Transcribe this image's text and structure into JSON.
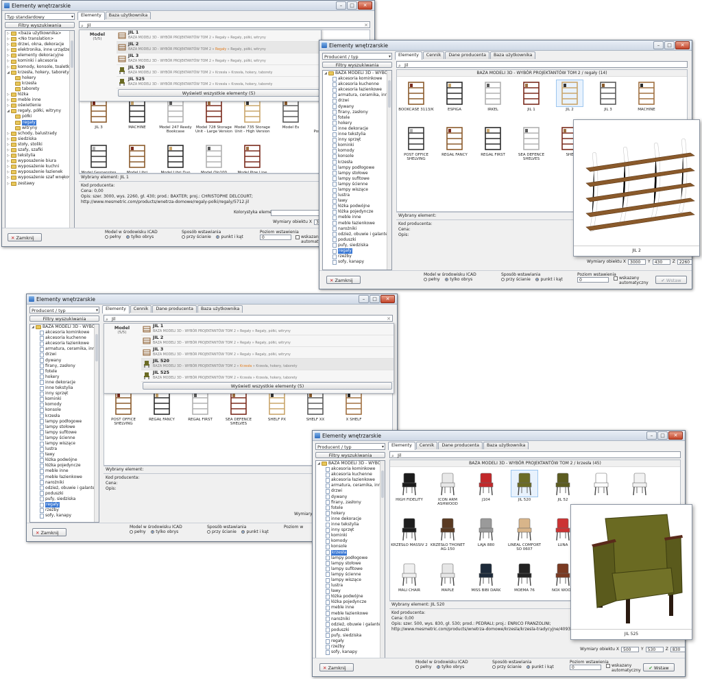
{
  "windows": {
    "w1": {
      "title": "Elementy wnętrzarskie",
      "combo": "Typ standardowy",
      "filter_btn": "Filtry wyszukiwania",
      "tabs": [
        "Elementy",
        "Baza użytkownika"
      ],
      "search_value": "Jil",
      "tree": [
        "<baza użytkownika>",
        "<No translation>",
        "drzwi, okna, dekoracje",
        "elektronika, inne urządzenia",
        "elementy dekoracyjne",
        "kominki i akcesoria",
        "komody, konsole, toaletki",
        "krzesła, hokery, taborety",
        "hokery",
        "krzesła",
        "taborety",
        "łóżka",
        "meble inne",
        "oświetlenie",
        "regały, półki, witryny",
        "półki",
        "regały",
        "witryny",
        "schody, balustrady",
        "siedziska",
        "stoły, stoliki",
        "szafy, szafki",
        "tekstylia",
        "wyposażenie biura",
        "wyposażenie kuchni",
        "wyposażenie łazienek",
        "wyposażenie szaf wnękowych",
        "zestawy"
      ],
      "popup": {
        "label": "Model",
        "count": "(5/5)",
        "rows": [
          {
            "name": "JIL 1",
            "path": "BAZA MODELI 3D - WYBÓR PROJEKTANTÓW TOM 2 » Regały » Regały, półki, witryny"
          },
          {
            "name": "JIL 2",
            "path_a": "BAZA MODELI 3D - WYBÓR PROJEKTANTÓW TOM 2 » ",
            "path_hl": "Regały",
            "path_b": " » Regały, półki, witryny"
          },
          {
            "name": "JIL 3",
            "path": "BAZA MODELI 3D - WYBÓR PROJEKTANTÓW TOM 2 » Regały » Regały, półki, witryny"
          },
          {
            "name": "JIL 520",
            "path": "BAZA MODELI 3D - WYBÓR PROJEKTANTÓW TOM 2 » Krzesła » Krzesła, hokery, taborety"
          },
          {
            "name": "JIL 525",
            "path": "BAZA MODELI 3D - WYBÓR PROJEKTANTÓW TOM 2 » Krzesła » Krzesła, hokery, taborety"
          }
        ],
        "show_all": "Wyświetl wszystkie elementy (5)"
      },
      "thumbs": [
        "JIL 3",
        "MACHINE",
        "Model 247 Reedy Bookcase",
        "Model 728 Storage Unit - Large Version",
        "Model 735 Storage Unit - High Version",
        "Model Es",
        "Model Frip Postmeister 259",
        "Model Gespanntes Regal",
        "Model Libri",
        "Model Libri Duo",
        "Model Olo100",
        "Model Pipe Line"
      ],
      "selected": "Wybrany element: JIL 1",
      "info_code": "Kod producenta:",
      "info_price": "Cena: 0,00",
      "info_desc": "Opis: szer. 3000, wys. 2260, gł. 430; prod.: BAXTER; proj.: CHRISTOPHE DELCOURT;",
      "info_url": "http://www.mesmetric.com/products/wnetrza-domowe/regaly-polki/regaly/5712.jil",
      "char_label": "Kolorystyka elementu",
      "dims_label": "Wymiary obiektu",
      "dim_x_label": "X",
      "dim_x": "3000",
      "close": "Zamknij",
      "model_label": "Model w środowisku ICAD",
      "model_opt1": "pełny",
      "model_opt2": "tylko obrys",
      "mode_label": "Sposób wstawiania",
      "mode_opt1": "przy ścianie",
      "mode_opt2": "punkt i kąt",
      "level_label": "Poziom wstawienia",
      "level_value": "0",
      "auto_label": "wskazany",
      "auto_label2": "automatyczny"
    },
    "w2": {
      "title": "Elementy wnętrzarskie",
      "combo": "Producent / typ",
      "filter_btn": "Filtry wyszukiwania",
      "tabs": [
        "Elementy",
        "Cennik",
        "Dane producenta",
        "Baza użytkownika"
      ],
      "search_value": "Jil",
      "tree_root": "BAZA MODELI 3D - WYBÓR P",
      "tree": [
        "akcesoria kominkowe",
        "akcesoria kuchenne",
        "akcesoria łazienkowe",
        "armatura, ceramika, inne",
        "drzwi",
        "dywany",
        "firany, zasłony",
        "fotele",
        "hokery",
        "inne dekoracje",
        "inne tekstylia",
        "inny sprzęt",
        "kominki",
        "komody",
        "konsole",
        "krzesła",
        "lampy podłogowe",
        "lampy stołowe",
        "lampy sufitowe",
        "lampy ścienne",
        "lampy wiszące",
        "lustra",
        "ławy",
        "łóżka podwójne",
        "łóżka pojedyncze",
        "meble inne",
        "meble łazienkowe",
        "narożniki",
        "odzież, obuwie i galanteria",
        "poduszki",
        "pufy, siedziska",
        "regały",
        "rzeźby",
        "sofy, kanapy"
      ],
      "selected_tree": "regały",
      "grid_header": "BAZA MODELI 3D - WYBÓR PROJEKTANTÓW TOM 2 / regały (14)",
      "thumbs": [
        "BOOKCASE 3113/K",
        "ESPIGA",
        "IRKEL",
        "JIL 1",
        "JIL 2",
        "JIL 3",
        "MACHINE",
        "POST OFFICE SHELVING",
        "REGAŁ FANCY",
        "REGAŁ FIRST",
        "SEA DEFENCE SHELVES",
        "SHE"
      ],
      "selected": "Wybrany element:",
      "info_code": "Kod producenta:",
      "info_price": "Cena:",
      "info_desc": "Opis:",
      "preview_caption": "JIL 2",
      "dims_label": "Wymiary obiektu",
      "dim_x_label": "X",
      "dim_x": "3000",
      "dim_y_label": "Y",
      "dim_y": "430",
      "dim_z_label": "Z",
      "dim_z": "2260",
      "close": "Zamknij",
      "model_label": "Model w środowisku ICAD",
      "model_opt1": "pełny",
      "model_opt2": "tylko obrys",
      "mode_label": "Sposób wstawiania",
      "mode_opt1": "przy ścianie",
      "mode_opt2": "punkt i kąt",
      "level_label": "Poziom wstawienia",
      "level_value": "0",
      "auto_label": "wskazany",
      "auto_label2": "automatyczny",
      "ok": "Wstaw"
    },
    "w3": {
      "title": "Elementy wnętrzarskie",
      "combo": "Producent / typ",
      "filter_btn": "Filtry wyszukiwania",
      "tabs": [
        "Elementy",
        "Cennik",
        "Dane producenta",
        "Baza użytkownika"
      ],
      "search_value": "Jil",
      "tree_root": "BAZA MODELI 3D - WYBÓR P",
      "tree": [
        "akcesoria kominkowe",
        "akcesoria kuchenne",
        "akcesoria łazienkowe",
        "armatura, ceramika, inne",
        "drzwi",
        "dywany",
        "firany, zasłony",
        "fotele",
        "hokery",
        "inne dekoracje",
        "inne tekstylia",
        "inny sprzęt",
        "kominki",
        "komody",
        "konsole",
        "krzesła",
        "lampy podłogowe",
        "lampy stołowe",
        "lampy sufitowe",
        "lampy ścienne",
        "lampy wiszące",
        "lustra",
        "ławy",
        "łóżka podwójne",
        "łóżka pojedyncze",
        "meble inne",
        "meble łazienkowe",
        "narożniki",
        "odzież, obuwie i galanteria",
        "poduszki",
        "pufy, siedziska",
        "regały",
        "rzeźby",
        "sofy, kanapy"
      ],
      "selected_tree": "regały",
      "popup": {
        "label": "Model",
        "count": "(5/5)",
        "rows": [
          {
            "name": "JIL 1",
            "path": "BAZA MODELI 3D - WYBÓR PROJEKTANTÓW TOM 2 » Regały » Regały, półki, witryny"
          },
          {
            "name": "JIL 2",
            "path": "BAZA MODELI 3D - WYBÓR PROJEKTANTÓW TOM 2 » Regały » Regały, półki, witryny"
          },
          {
            "name": "JIL 3",
            "path": "BAZA MODELI 3D - WYBÓR PROJEKTANTÓW TOM 2 » Regały » Regały, półki, witryny"
          },
          {
            "name": "JIL 520",
            "path_a": "BAZA MODELI 3D - WYBÓR PROJEKTANTÓW TOM 2 » ",
            "path_hl": "Krzesła",
            "path_b": " » Krzesła, hokery, taborety"
          },
          {
            "name": "JIL 525",
            "path": "BAZA MODELI 3D - WYBÓR PROJEKTANTÓW TOM 2 » Krzesła » Krzesła, hokery, taborety"
          }
        ],
        "show_all": "Wyświetl wszystkie elementy (5)"
      },
      "thumbs": [
        "POST OFFICE SHELVING",
        "REGAŁ FANCY",
        "REGAŁ FIRST",
        "SEA DEFENCE SHELVES",
        "SHELF PX",
        "SHELF XX",
        "X SHELF"
      ],
      "selected": "Wybrany element:",
      "info_code": "Kod producenta:",
      "info_price": "Cena:",
      "info_desc": "Opis:",
      "dims_label": "Wymiary obi",
      "close": "Zamknij",
      "model_label": "Model w środowisku ICAD",
      "model_opt1": "pełny",
      "model_opt2": "tylko obrys",
      "mode_label": "Sposób wstawiania",
      "mode_opt1": "przy ścianie",
      "mode_opt2": "punkt i kąt",
      "level_label": "Poziom w"
    },
    "w4": {
      "title": "Elementy wnętrzarskie",
      "combo": "Producent / typ",
      "filter_btn": "Filtry wyszukiwania",
      "tabs": [
        "Elementy",
        "Cennik",
        "Dane producenta",
        "Baza użytkownika"
      ],
      "search_value": "Jil",
      "tree_root": "BAZA MODELI 3D - WYBÓR P",
      "tree": [
        "akcesoria kominkowe",
        "akcesoria kuchenne",
        "akcesoria łazienkowe",
        "armatura, ceramika, inne",
        "drzwi",
        "dywany",
        "firany, zasłony",
        "fotele",
        "hokery",
        "inne dekoracje",
        "inne tekstylia",
        "inny sprzęt",
        "kominki",
        "komody",
        "konsole",
        "krzesła",
        "lampy podłogowe",
        "lampy stołowe",
        "lampy sufitowe",
        "lampy ścienne",
        "lampy wiszące",
        "lustra",
        "ławy",
        "łóżka podwójne",
        "łóżka pojedyncze",
        "meble inne",
        "meble łazienkowe",
        "narożniki",
        "odzież, obuwie i galanteria",
        "poduszki",
        "pufy, siedziska",
        "regały",
        "rzeźby",
        "sofy, kanapy"
      ],
      "selected_tree": "krzesła",
      "grid_header": "BAZA MODELI 3D - WYBÓR PROJEKTANTÓW TOM 2 / krzesła (45)",
      "thumbs": [
        "HIGH FIDELITY",
        "ICON ARM ASHWOOD",
        "J104",
        "JIL 520",
        "JIL 52",
        "",
        "",
        "KRZESŁO MASSIV 2",
        "KRZESŁO THONET AG-150",
        "LAJA 880",
        "LINEAL COMFORT SO 0607",
        "LUNA",
        "",
        "",
        "MALI CHAIR",
        "MAPLE",
        "MISS BIBI DARK",
        "MOEMA 76",
        "NOX WOOD"
      ],
      "selected": "Wybrany element: JIL 520",
      "info_code": "Kod producenta:",
      "info_price": "Cena: 0,00",
      "info_desc": "Opis: szer. 500, wys. 830, gł. 530; prod.: PEDRALI; proj.: ENRICO FRANZOLINI;",
      "info_url": "http://www.mesmetric.com/products/wnetrza-domowe/krzesla/krzesla-tradycyjne/4093.jil_520",
      "preview_caption": "JIL 525",
      "dims_label": "Wymiary obiektu",
      "dim_x_label": "X",
      "dim_x": "500",
      "dim_y_label": "Y",
      "dim_y": "530",
      "dim_z_label": "Z",
      "dim_z": "830",
      "close": "Zamknij",
      "model_label": "Model w środowisku ICAD",
      "model_opt1": "pełny",
      "model_opt2": "tylko obrys",
      "mode_label": "Sposób wstawiania",
      "mode_opt1": "przy ścianie",
      "mode_opt2": "punkt i kąt",
      "level_label": "Poziom wstawienia",
      "level_value": "0",
      "auto_label": "wskazany",
      "auto_label2": "automatyczny",
      "ok": "Wstaw"
    }
  },
  "colors": {
    "accent": "#3a78d4",
    "close_x": "#c81c1c",
    "highlight_path": "#e07b1c",
    "ok_check": "#2e9a2e"
  }
}
